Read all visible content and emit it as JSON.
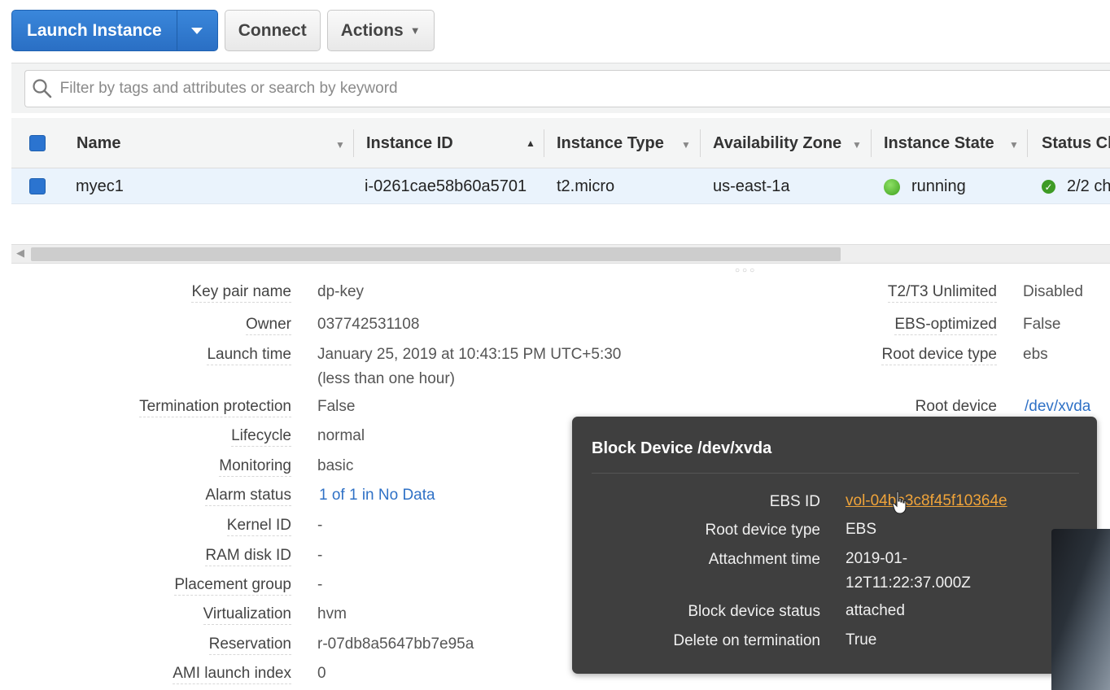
{
  "toolbar": {
    "launch_label": "Launch Instance",
    "connect_label": "Connect",
    "actions_label": "Actions"
  },
  "search": {
    "placeholder": "Filter by tags and attributes or search by keyword"
  },
  "table": {
    "columns": [
      "Name",
      "Instance ID",
      "Instance Type",
      "Availability Zone",
      "Instance State",
      "Status Ch"
    ],
    "rows": [
      {
        "name": "myec1",
        "instance_id": "i-0261cae58b60a5701",
        "instance_type": "t2.micro",
        "availability_zone": "us-east-1a",
        "instance_state": "running",
        "status_checks": "2/2 ch"
      }
    ]
  },
  "details": {
    "left": [
      {
        "label": "Key pair name",
        "value": "dp-key"
      },
      {
        "label": "Owner",
        "value": "037742531108"
      },
      {
        "label": "Launch time",
        "value": "January 25, 2019 at 10:43:15 PM UTC+5:30",
        "value2": "(less than one hour)"
      },
      {
        "label": "Termination protection",
        "value": "False"
      },
      {
        "label": "Lifecycle",
        "value": "normal"
      },
      {
        "label": "Monitoring",
        "value": "basic"
      },
      {
        "label": "Alarm status",
        "value": "1 of 1 in No Data"
      },
      {
        "label": "Kernel ID",
        "value": "-"
      },
      {
        "label": "RAM disk ID",
        "value": "-"
      },
      {
        "label": "Placement group",
        "value": "-"
      },
      {
        "label": "Virtualization",
        "value": "hvm"
      },
      {
        "label": "Reservation",
        "value": "r-07db8a5647bb7e95a"
      },
      {
        "label": "AMI launch index",
        "value": "0"
      }
    ],
    "right": [
      {
        "label": "T2/T3 Unlimited",
        "value": "Disabled"
      },
      {
        "label": "EBS-optimized",
        "value": "False"
      },
      {
        "label": "Root device type",
        "value": "ebs"
      },
      {
        "label": "Root device",
        "value": "/dev/xvda"
      }
    ]
  },
  "popover": {
    "title": "Block Device /dev/xvda",
    "rows": [
      {
        "label": "EBS ID",
        "value": "vol-04bb3c8f45f10364e"
      },
      {
        "label": "Root device type",
        "value": "EBS"
      },
      {
        "label": "Attachment time",
        "value": "2019-01-",
        "value2": "12T11:22:37.000Z"
      },
      {
        "label": "Block device status",
        "value": "attached"
      },
      {
        "label": "Delete on termination",
        "value": "True"
      }
    ]
  },
  "colors": {
    "primary": "#2d78cf",
    "running": "#3ea11c",
    "popover_bg": "#3f3f3f",
    "link": "#2f71c6",
    "ebs_link": "#f0a43a"
  }
}
